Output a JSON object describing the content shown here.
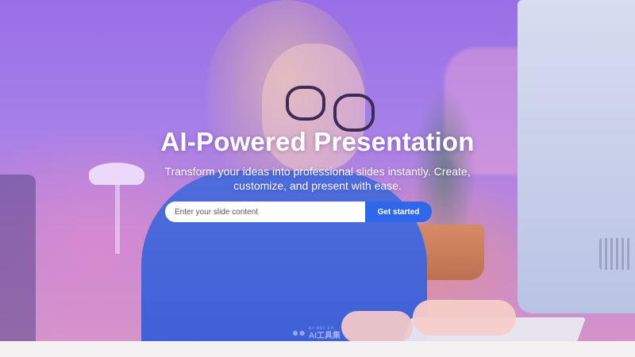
{
  "hero": {
    "title": "AI-Powered Presentation",
    "subtitle": "Transform your ideas into professional slides instantly. Create, customize, and present with ease."
  },
  "form": {
    "input_placeholder": "Enter your slide content",
    "input_value": "",
    "button_label": "Get started"
  },
  "watermark": {
    "small_text": "ai-bot.cn",
    "big_text": "AI工具集",
    "icon": "robot-icon"
  },
  "colors": {
    "button": "#2f67ea",
    "overlay_top": "#9a6ee6",
    "overlay_bottom": "#d994c7"
  }
}
